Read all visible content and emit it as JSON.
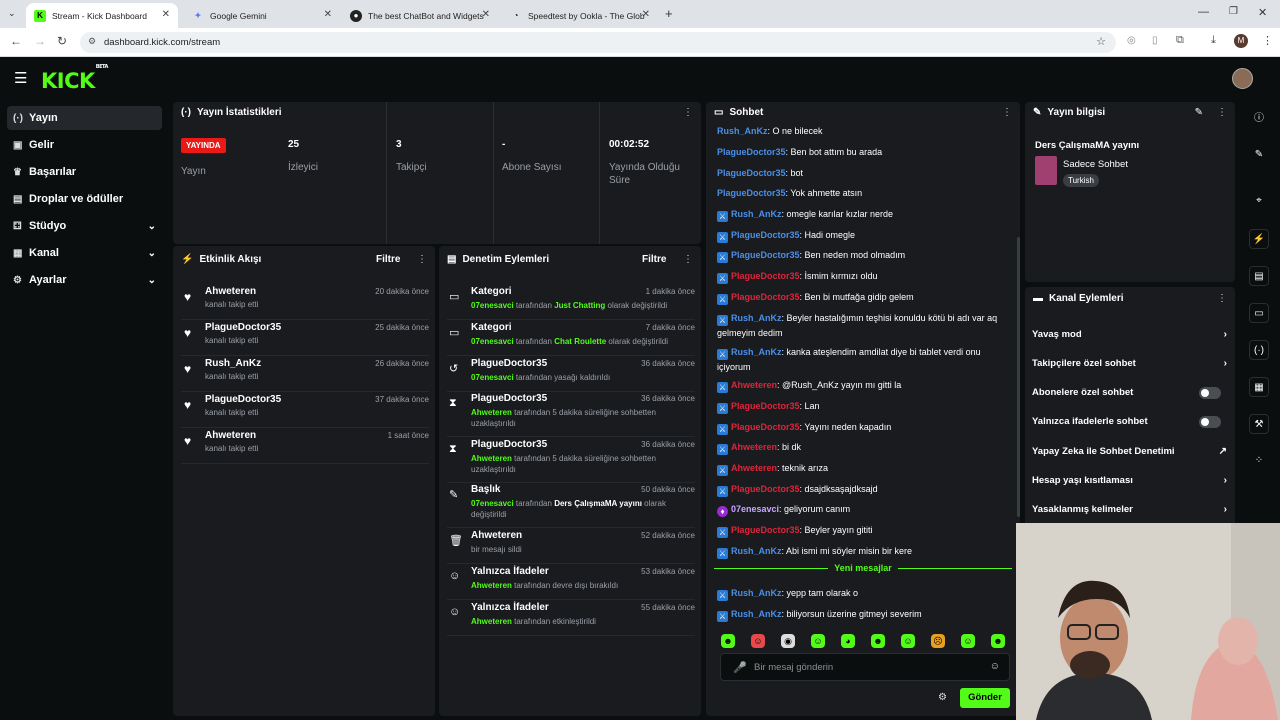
{
  "browser": {
    "tabs": [
      {
        "title": "Stream - Kick Dashboard",
        "icon": "kick-favicon"
      },
      {
        "title": "Google Gemini",
        "icon": "gemini-favicon"
      },
      {
        "title": "The best ChatBot and Widgets",
        "icon": "github-favicon"
      },
      {
        "title": "Speedtest by Ookla - The Glob",
        "icon": "speedtest-favicon"
      }
    ],
    "url": "dashboard.kick.com/stream",
    "profile_initial": "M"
  },
  "app": {
    "logo": "KICK",
    "logo_badge": "BETA"
  },
  "sidebar": {
    "items": [
      {
        "label": "Yayın",
        "icon": "broadcast-icon"
      },
      {
        "label": "Gelir",
        "icon": "wallet-icon"
      },
      {
        "label": "Başarılar",
        "icon": "trophy-icon"
      },
      {
        "label": "Droplar ve ödüller",
        "icon": "gift-icon"
      },
      {
        "label": "Stüdyo",
        "icon": "studio-icon"
      },
      {
        "label": "Kanal",
        "icon": "channel-icon"
      },
      {
        "label": "Ayarlar",
        "icon": "gear-icon"
      }
    ]
  },
  "stats": {
    "title": "Yayın İstatistikleri",
    "live_badge": "YAYINDA",
    "live_label": "Yayın",
    "viewers": "25",
    "viewers_label": "İzleyici",
    "followers": "3",
    "followers_label": "Takipçi",
    "subs": "-",
    "subs_label": "Abone Sayısı",
    "duration": "00:02:52",
    "duration_label": "Yayında Olduğu Süre"
  },
  "activity": {
    "title": "Etkinlik Akışı",
    "filter": "Filtre",
    "items": [
      {
        "name": "Ahweteren",
        "sub": "kanalı takip etti",
        "time": "20 dakika önce"
      },
      {
        "name": "PlagueDoctor35",
        "sub": "kanalı takip etti",
        "time": "25 dakika önce"
      },
      {
        "name": "Rush_AnKz",
        "sub": "kanalı takip etti",
        "time": "26 dakika önce"
      },
      {
        "name": "PlagueDoctor35",
        "sub": "kanalı takip etti",
        "time": "37 dakika önce"
      },
      {
        "name": "Ahweteren",
        "sub": "kanalı takip etti",
        "time": "1 saat önce"
      }
    ]
  },
  "moderation": {
    "title": "Denetim Eylemleri",
    "filter": "Filtre",
    "items": [
      {
        "name": "Kategori",
        "actor": "07enesavci",
        "mid": " tarafından ",
        "obj": "Just Chatting",
        "tail": " olarak değiştirildi",
        "time": "1 dakika önce"
      },
      {
        "name": "Kategori",
        "actor": "07enesavci",
        "mid": " tarafından ",
        "obj": "Chat Roulette",
        "tail": " olarak değiştirildi",
        "time": "7 dakika önce"
      },
      {
        "name": "PlagueDoctor35",
        "actor": "07enesavci",
        "mid": " tarafından yasağı kaldırıldı",
        "obj": "",
        "tail": "",
        "time": "36 dakika önce"
      },
      {
        "name": "PlagueDoctor35",
        "actor": "Ahweteren",
        "mid": " tarafından 5 dakika süreliğine sohbetten uzaklaştırıldı",
        "obj": "",
        "tail": "",
        "time": "36 dakika önce"
      },
      {
        "name": "PlagueDoctor35",
        "actor": "Ahweteren",
        "mid": " tarafından 5 dakika süreliğine sohbetten uzaklaştırıldı",
        "obj": "",
        "tail": "",
        "time": "36 dakika önce"
      },
      {
        "name": "Başlık",
        "actor": "07enesavci",
        "mid": " tarafından ",
        "obj": "Ders ÇalışmaMA yayını",
        "tail": " olarak değiştirildi",
        "time": "50 dakika önce"
      },
      {
        "name": "Ahweteren",
        "actor": "",
        "mid": "bir mesajı sildi",
        "obj": "",
        "tail": "",
        "time": "52 dakika önce"
      },
      {
        "name": "Yalnızca İfadeler",
        "actor": "Ahweteren",
        "mid": " tarafından devre dışı bırakıldı",
        "obj": "",
        "tail": "",
        "time": "53 dakika önce"
      },
      {
        "name": "Yalnızca İfadeler",
        "actor": "Ahweteren",
        "mid": " tarafından etkinleştirildi",
        "obj": "",
        "tail": "",
        "time": "55 dakika önce"
      }
    ]
  },
  "chat": {
    "title": "Sohbet",
    "messages": [
      {
        "user": "Rush_AnKz",
        "color": "#4a8fe8",
        "text": ": O ne bilecek",
        "badge": ""
      },
      {
        "user": "PlagueDoctor35",
        "color": "#4a8fe8",
        "text": ": Ben bot attım bu arada",
        "badge": ""
      },
      {
        "user": "PlagueDoctor35",
        "color": "#4a8fe8",
        "text": ": bot",
        "badge": ""
      },
      {
        "user": "PlagueDoctor35",
        "color": "#4a8fe8",
        "text": ": Yok ahmette atsın",
        "badge": ""
      },
      {
        "user": "Rush_AnKz",
        "color": "#4a8fe8",
        "text": ": omegle karılar kızlar nerde",
        "badge": "b"
      },
      {
        "user": "PlagueDoctor35",
        "color": "#4a8fe8",
        "text": ": Hadi omegle",
        "badge": "b"
      },
      {
        "user": "PlagueDoctor35",
        "color": "#4a8fe8",
        "text": ": Ben neden mod olmadım",
        "badge": "b"
      },
      {
        "user": "PlagueDoctor35",
        "color": "#e0243a",
        "text": ": İsmim kırmızı oldu",
        "badge": "b"
      },
      {
        "user": "PlagueDoctor35",
        "color": "#e0243a",
        "text": ": Ben bi mutfağa gidip gelem",
        "badge": "b"
      },
      {
        "user": "Rush_AnKz",
        "color": "#4a8fe8",
        "text": ": Beyler hastalığımın teşhisi konuldu kötü bi adı var aq gelmeyim dedim",
        "badge": "b"
      },
      {
        "user": "Rush_AnKz",
        "color": "#4a8fe8",
        "text": ": kanka ateşlendim amdilat diye bi tablet verdi onu içiyorum",
        "badge": "b"
      },
      {
        "user": "Ahweteren",
        "color": "#e0243a",
        "text": ": @Rush_AnKz yayın mı gitti la",
        "badge": "b"
      },
      {
        "user": "PlagueDoctor35",
        "color": "#e0243a",
        "text": ": Lan",
        "badge": "b"
      },
      {
        "user": "PlagueDoctor35",
        "color": "#e0243a",
        "text": ": Yayını neden kapadın",
        "badge": "b"
      },
      {
        "user": "Ahweteren",
        "color": "#e0243a",
        "text": ": bi dk",
        "badge": "b"
      },
      {
        "user": "Ahweteren",
        "color": "#e0243a",
        "text": ": teknik arıza",
        "badge": "b"
      },
      {
        "user": "PlagueDoctor35",
        "color": "#e0243a",
        "text": ": dsajdksaşajdksajd",
        "badge": "b"
      },
      {
        "user": "07enesavci",
        "color": "#c8a8ff",
        "text": ": geliyorum canım",
        "badge": "p"
      },
      {
        "user": "PlagueDoctor35",
        "color": "#e0243a",
        "text": ": Beyler yayın gititi",
        "badge": "b"
      },
      {
        "user": "Rush_AnKz",
        "color": "#4a8fe8",
        "text": ": Abi ismi mi söyler misin bir kere",
        "badge": "b"
      }
    ],
    "new_messages_label": "Yeni mesajlar",
    "new_messages": [
      {
        "user": "Rush_AnKz",
        "color": "#4a8fe8",
        "text": ": yepp tam olarak o",
        "badge": "b"
      },
      {
        "user": "Rush_AnKz",
        "color": "#4a8fe8",
        "text": ": biliyorsun üzerine gitmeyi severim",
        "badge": "b"
      }
    ],
    "input_placeholder": "Bir mesaj gönderin",
    "send_label": "Gönder"
  },
  "stream_info": {
    "title": "Yayın bilgisi",
    "stream_title": "Ders ÇalışmaMA yayını",
    "category": "Sadece Sohbet",
    "language": "Turkish"
  },
  "channel_actions": {
    "title": "Kanal Eylemleri",
    "items": [
      {
        "label": "Yavaş mod",
        "control": "chevron"
      },
      {
        "label": "Takipçilere özel sohbet",
        "control": "chevron"
      },
      {
        "label": "Abonelere özel sohbet",
        "control": "toggle",
        "on": false
      },
      {
        "label": "Yalnızca ifadelerle sohbet",
        "control": "toggle",
        "on": false
      },
      {
        "label": "Yapay Zeka ile Sohbet Denetimi",
        "control": "external"
      },
      {
        "label": "Hesap yaşı kısıtlaması",
        "control": "chevron"
      },
      {
        "label": "Yasaklanmış kelimeler",
        "control": "chevron"
      }
    ]
  },
  "colors": {
    "accent": "#53fc18",
    "live": "#e91916",
    "panel": "#191b1f",
    "bg": "#0b0e0f"
  }
}
